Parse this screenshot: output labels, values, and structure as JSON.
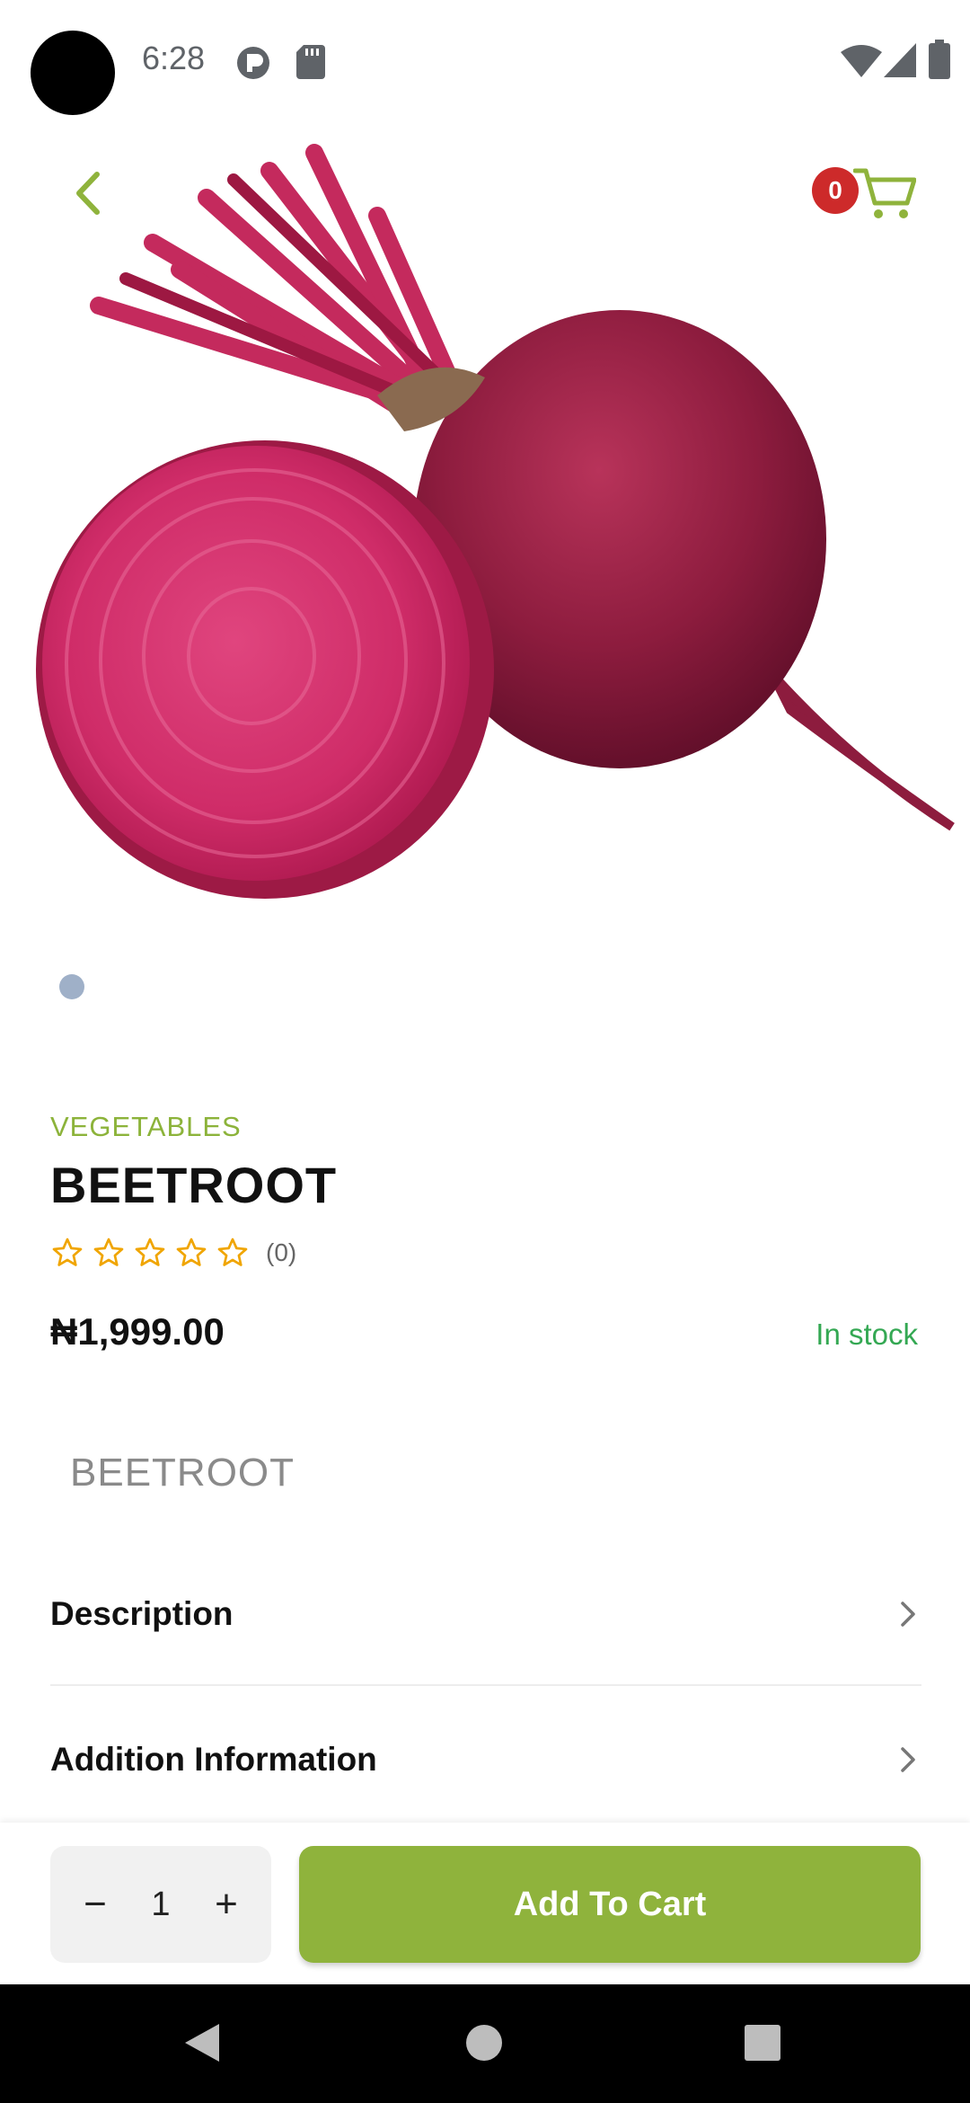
{
  "status_bar": {
    "time": "6:28"
  },
  "header": {
    "cart_count": "0"
  },
  "product": {
    "category": "VEGETABLES",
    "name": "BEETROOT",
    "rating_count": "(0)",
    "rating_value": 0,
    "price": "₦1,999.00",
    "stock_status": "In stock",
    "variant_label": "BEETROOT"
  },
  "sections": [
    {
      "label": "Description"
    },
    {
      "label": "Addition Information"
    }
  ],
  "cart_controls": {
    "decrement": "−",
    "quantity": "1",
    "increment": "+",
    "add_label": "Add To Cart"
  },
  "colors": {
    "accent": "#8fb33c",
    "stock": "#34a853",
    "badge": "#cd2a2a",
    "star": "#f0a500"
  }
}
